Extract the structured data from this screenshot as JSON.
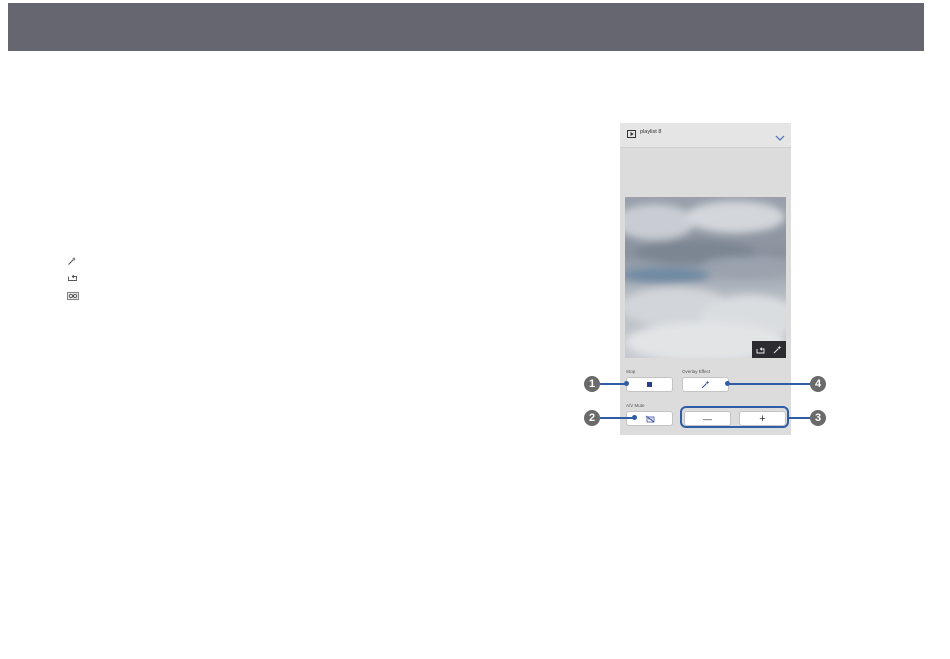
{
  "player": {
    "playlist_name": "playlist 8"
  },
  "icons": {
    "legend": [
      "overlay-effect-icon",
      "repeat-icon",
      "loop-mode-icon"
    ],
    "preview_tools": [
      "repeat-icon",
      "overlay-effect-icon"
    ]
  },
  "controls": {
    "stop_label": "Stop",
    "overlay_label": "Overlay Effect",
    "av_mute_label": "A/V Mute",
    "minus_label": "—",
    "plus_label": "+"
  },
  "callouts": {
    "one": "1",
    "two": "2",
    "three": "3",
    "four": "4"
  },
  "colors": {
    "header_bar": "#666670",
    "callout_blue": "#2f5ea6",
    "stop_square": "#2b3d8f"
  }
}
